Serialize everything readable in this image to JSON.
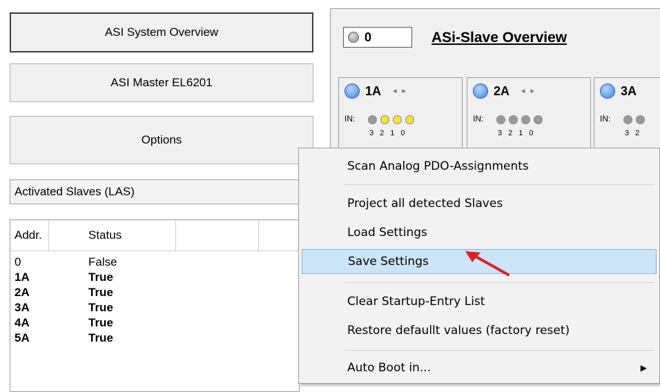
{
  "nav": {
    "overview_label": "ASI System Overview",
    "master_label": "ASI Master EL6201",
    "options_label": "Options"
  },
  "filter": {
    "selected": "Activated Slaves (LAS)"
  },
  "table": {
    "headers": [
      "Addr.",
      "Status"
    ],
    "rows": [
      {
        "addr": "0",
        "status": "False"
      },
      {
        "addr": "1A",
        "status": "True"
      },
      {
        "addr": "2A",
        "status": "True"
      },
      {
        "addr": "3A",
        "status": "True"
      },
      {
        "addr": "4A",
        "status": "True"
      },
      {
        "addr": "5A",
        "status": "True"
      }
    ]
  },
  "slave_overview": {
    "counter": "0",
    "title": "ASi-Slave Overview",
    "slaves": [
      {
        "id": "1A",
        "in_label": "IN:",
        "bits": [
          "3",
          "2",
          "1",
          "0"
        ],
        "leds": [
          "gray",
          "yellow",
          "yellow",
          "yellow"
        ]
      },
      {
        "id": "2A",
        "in_label": "IN:",
        "bits": [
          "3",
          "2",
          "1",
          "0"
        ],
        "leds": [
          "gray",
          "gray",
          "gray",
          "gray"
        ]
      },
      {
        "id": "3A",
        "in_label": "IN:",
        "bits": [
          "3",
          "2"
        ],
        "leds": [
          "gray",
          "gray"
        ]
      }
    ]
  },
  "context_menu": {
    "items": [
      "Scan Analog PDO-Assignments",
      "Project all detected Slaves",
      "Load Settings",
      "Save Settings",
      "Clear Startup-Entry List",
      "Restore defaullt values (factory reset)",
      "Auto Boot in..."
    ],
    "highlighted": "Save Settings"
  },
  "colors": {
    "highlight": "#cce4f7",
    "arrow": "#e02020",
    "led_blue": "#4a8ee8",
    "led_yellow": "#f3e33a",
    "led_gray": "#9a9a9a"
  }
}
